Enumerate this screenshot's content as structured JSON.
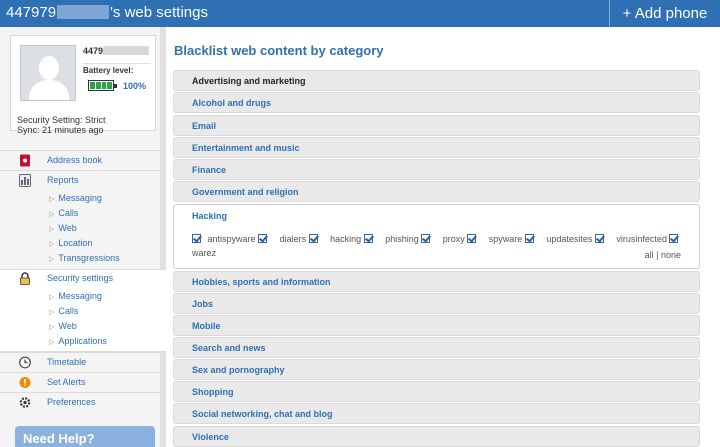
{
  "header": {
    "title_prefix": "447979",
    "title_suffix": "'s web settings",
    "add_phone": "+ Add phone"
  },
  "profile": {
    "phone_prefix": "4479",
    "battery_label": "Battery level:",
    "battery_percent": "100%",
    "battery_level": 1.0,
    "security_setting": "Security Setting: Strict",
    "sync": "Sync: 21 minutes ago"
  },
  "sidebar": {
    "address_book": "Address book",
    "reports": "Reports",
    "reports_sub": [
      "Messaging",
      "Calls",
      "Web",
      "Location",
      "Transgressions"
    ],
    "security_settings": "Security settings",
    "security_sub": [
      "Messaging",
      "Calls",
      "Web",
      "Applications"
    ],
    "timetable": "Timetable",
    "set_alerts": "Set Alerts",
    "preferences": "Preferences",
    "need_help": "Need Help?"
  },
  "main": {
    "title": "Blacklist web content by category",
    "categories_top": [
      "Advertising and marketing",
      "Alcohol and drugs",
      "Email",
      "Entertainment and music",
      "Finance",
      "Government and religion"
    ],
    "expanded": {
      "name": "Hacking",
      "options": [
        "antispyware",
        "dialers",
        "hacking",
        "phishing",
        "proxy",
        "spyware",
        "updatesites",
        "virusinfected",
        "warez"
      ],
      "all": "all",
      "sep": "|",
      "none": "none"
    },
    "categories_bottom": [
      "Hobbies, sports and information",
      "Jobs",
      "Mobile",
      "Search and news",
      "Sex and pornography",
      "Shopping",
      "Social networking, chat and blog",
      "Violence"
    ]
  }
}
